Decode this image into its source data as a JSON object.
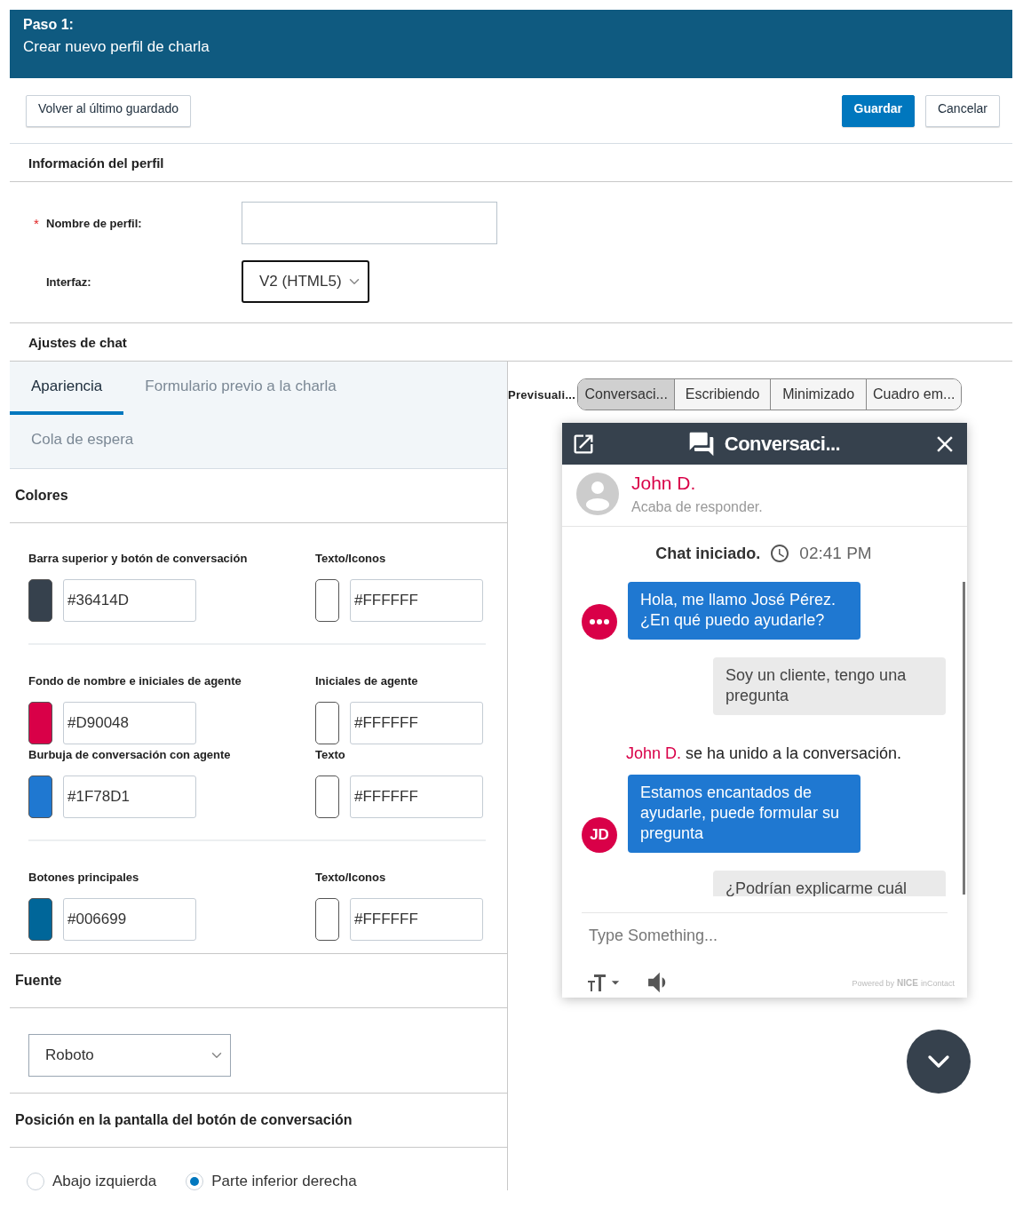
{
  "header": {
    "step": "Paso 1:",
    "title": "Crear nuevo perfil de charla"
  },
  "toolbar": {
    "revert": "Volver al último guardado",
    "save": "Guardar",
    "cancel": "Cancelar"
  },
  "profile": {
    "heading": "Información del perfil",
    "fields": [
      {
        "kind": "text",
        "label": "Nombre de perfil:",
        "required_mark": "*"
      },
      {
        "kind": "select",
        "label": "Interfaz:",
        "value": "V2 (HTML5)"
      }
    ]
  },
  "chat_settings": {
    "heading": "Ajustes de chat",
    "tabs": [
      {
        "label": "Apariencia",
        "selected": true
      },
      {
        "label": "Formulario previo a la charla",
        "selected": false
      },
      {
        "label": "Cola de espera",
        "selected": false
      }
    ]
  },
  "colors": {
    "heading": "Colores",
    "groups": [
      {
        "rows": [
          [
            {
              "label": "Barra superior y botón de conversación",
              "value": "#36414D",
              "color": "#36414d"
            },
            {
              "label": "Texto/Iconos",
              "value": "#FFFFFF",
              "color": "#ffffff"
            }
          ]
        ]
      },
      {
        "rows": [
          [
            {
              "label": "Fondo de nombre e iniciales de agente",
              "value": "#D90048",
              "color": "#d90048"
            },
            {
              "label": "Iniciales de agente",
              "value": "#FFFFFF",
              "color": "#ffffff"
            }
          ],
          [
            {
              "label": "Burbuja de conversación con agente",
              "value": "#1F78D1",
              "color": "#1f78d1"
            },
            {
              "label": "Texto",
              "value": "#FFFFFF",
              "color": "#ffffff"
            }
          ]
        ]
      },
      {
        "rows": [
          [
            {
              "label": "Botones principales",
              "value": "#006699",
              "color": "#006699"
            },
            {
              "label": "Texto/Iconos",
              "value": "#FFFFFF",
              "color": "#ffffff"
            }
          ]
        ]
      }
    ]
  },
  "font": {
    "heading": "Fuente",
    "value": "Roboto"
  },
  "position": {
    "heading": "Posición en la pantalla del botón de conversación",
    "options": [
      {
        "label": "Abajo izquierda",
        "selected": false
      },
      {
        "label": "Parte inferior derecha",
        "selected": true
      }
    ]
  },
  "preview": {
    "label": "Previsuali...",
    "tabs": [
      {
        "label": "Conversaci...",
        "selected": true
      },
      {
        "label": "Escribiendo",
        "selected": false
      },
      {
        "label": "Minimizado",
        "selected": false
      },
      {
        "label": "Cuadro em...",
        "selected": false
      }
    ],
    "chat": {
      "title": "Conversaci...",
      "agent_name": "John D.",
      "agent_status": "Acaba de responder.",
      "started": "Chat iniciado.",
      "time": "02:41 PM",
      "messages": [
        {
          "kind": "agent",
          "avatar": {
            "kind": "typing"
          },
          "text": "Hola, me llamo José Pérez. ¿En qué puedo ayudarle?"
        },
        {
          "kind": "customer",
          "text": "Soy un cliente, tengo una pregunta"
        },
        {
          "kind": "system",
          "name": "John D.",
          "text": "se ha unido a la conversación."
        },
        {
          "kind": "agent",
          "avatar": {
            "kind": "initials",
            "text": "JD"
          },
          "text": "Estamos encantados de ayudarle, puede formular su pregunta"
        },
        {
          "kind": "customer",
          "text": "¿Podrían explicarme cuál"
        }
      ],
      "placeholder": "Type Something...",
      "powered_by": "Powered by",
      "logo": "NICE",
      "logo_suffix": "inContact"
    }
  }
}
